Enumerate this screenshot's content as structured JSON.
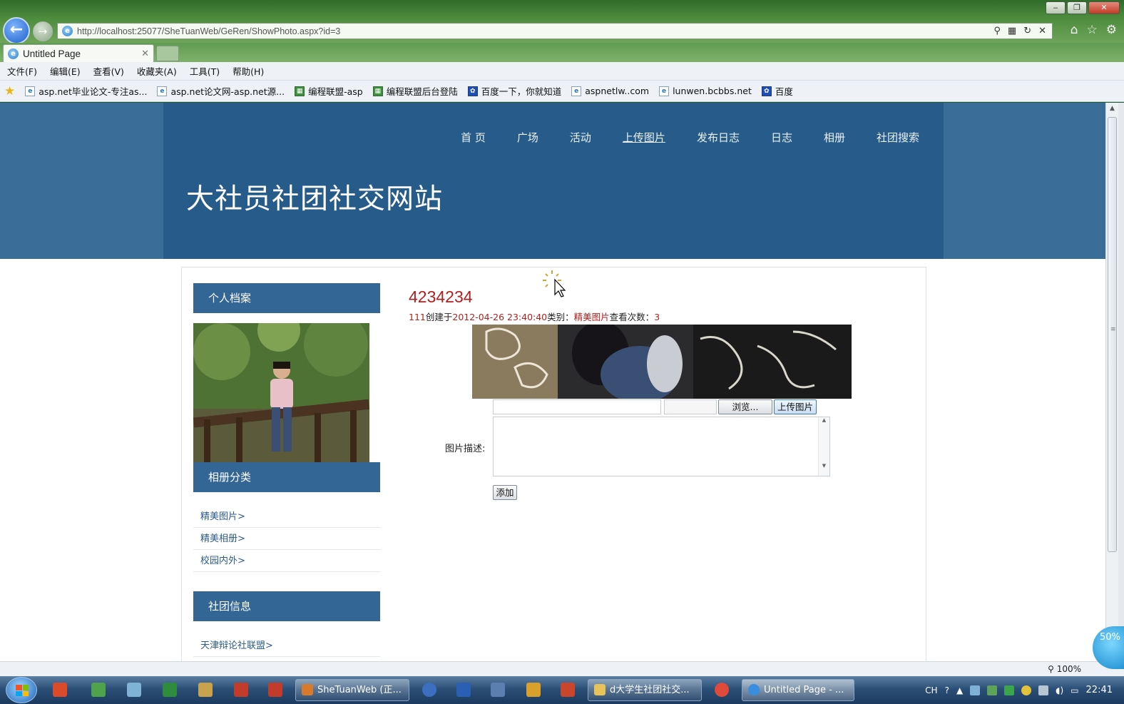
{
  "browser": {
    "url": "http://localhost:25077/SheTuanWeb/GeRen/ShowPhoto.aspx?id=3",
    "tab_title": "Untitled Page",
    "menu": [
      "文件(F)",
      "编辑(E)",
      "查看(V)",
      "收藏夹(A)",
      "工具(T)",
      "帮助(H)"
    ],
    "favorites": [
      {
        "label": "asp.net毕业论文-专注as...",
        "icon": "ie-page-icon"
      },
      {
        "label": "asp.net论文网-asp.net源...",
        "icon": "ie-page-icon"
      },
      {
        "label": "编程联盟-asp",
        "icon": "green-site-icon"
      },
      {
        "label": "编程联盟后台登陆",
        "icon": "green-site-icon"
      },
      {
        "label": "百度一下，你就知道",
        "icon": "baidu-paw-icon"
      },
      {
        "label": "aspnetlw..com",
        "icon": "ie-page-icon"
      },
      {
        "label": "lunwen.bcbbs.net",
        "icon": "ie-page-icon"
      },
      {
        "label": "百度",
        "icon": "baidu-paw-icon"
      }
    ],
    "zoom": "100%"
  },
  "site": {
    "title": "大社员社团社交网站",
    "nav": [
      "首 页",
      "广场",
      "活动",
      "上传图片",
      "发布日志",
      "日志",
      "相册",
      "社团搜索"
    ],
    "active_nav": "上传图片"
  },
  "sidebar": {
    "profile_heading": "个人档案",
    "album_heading": "相册分类",
    "album_links": [
      "精美图片>",
      "精美相册>",
      "校园内外>"
    ],
    "club_heading": "社团信息",
    "club_links": [
      "天津辩论社联盟>"
    ]
  },
  "photo": {
    "title": "4234234",
    "author": "111",
    "created_label": "创建于",
    "created": "2012-04-26 23:40:40",
    "category_label": "类别：",
    "category": "精美图片",
    "views_label": "查看次数：",
    "views": "3"
  },
  "form": {
    "browse_label": "浏览...",
    "upload_label": "上传图片",
    "desc_label": "图片描述:",
    "add_label": "添加"
  },
  "taskbar": {
    "tasks": [
      "SheTuanWeb (正...",
      "d大学生社团社交...",
      "Untitled Page - ..."
    ],
    "ime": "CH",
    "clock": "22:41"
  },
  "weather_badge": "50%",
  "colors": {
    "header_bg": "#3a6e99",
    "header_inner": "#275c8a",
    "sidebar_head": "#336694",
    "accent_red": "#b21f1f"
  }
}
